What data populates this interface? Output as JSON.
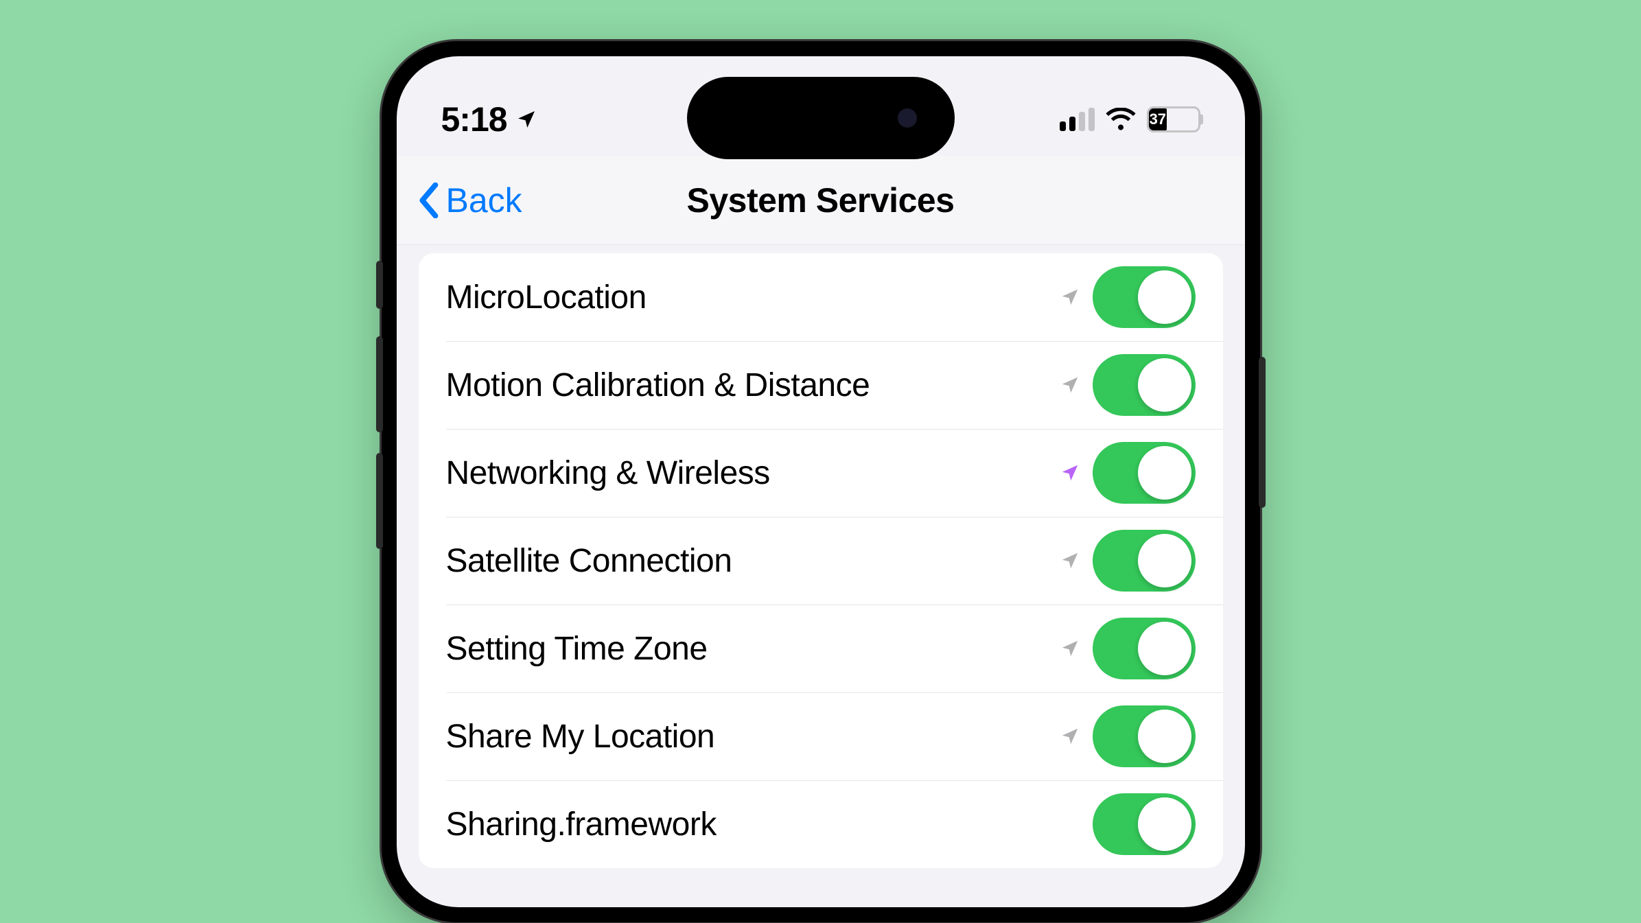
{
  "status": {
    "time": "5:18",
    "battery_pct": "37"
  },
  "nav": {
    "back_label": "Back",
    "title": "System Services"
  },
  "colors": {
    "accent_blue": "#007aff",
    "toggle_green": "#34c759",
    "arrow_recent": "#b964f7",
    "arrow_past": "#b0b0b2"
  },
  "rows": [
    {
      "label": "MicroLocation",
      "arrow": "past",
      "on": true
    },
    {
      "label": "Motion Calibration & Distance",
      "arrow": "past",
      "on": true
    },
    {
      "label": "Networking & Wireless",
      "arrow": "recent",
      "on": true
    },
    {
      "label": "Satellite Connection",
      "arrow": "past",
      "on": true
    },
    {
      "label": "Setting Time Zone",
      "arrow": "past",
      "on": true
    },
    {
      "label": "Share My Location",
      "arrow": "past",
      "on": true
    },
    {
      "label": "Sharing.framework",
      "arrow": null,
      "on": true
    }
  ]
}
